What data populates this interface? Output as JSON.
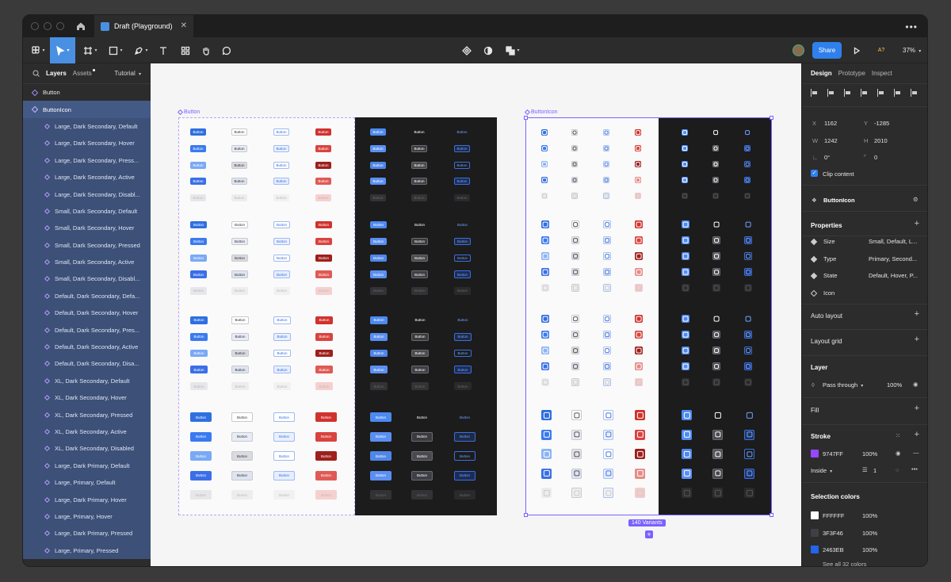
{
  "file_tab": {
    "title": "Draft (Playground)",
    "close": "✕"
  },
  "toolbar": {
    "share_label": "Share",
    "zoom": "37%",
    "ai_label": "A?"
  },
  "left_panel": {
    "tabs": {
      "layers": "Layers",
      "assets": "Assets",
      "page": "Tutorial"
    },
    "layers": [
      {
        "label": "Button",
        "level": "top"
      },
      {
        "label": "ButtonIcon",
        "level": "parent"
      },
      {
        "label": "Large, Dark Secondary, Default",
        "level": "child"
      },
      {
        "label": "Large, Dark Secondary, Hover",
        "level": "child"
      },
      {
        "label": "Large, Dark Secondary, Press...",
        "level": "child"
      },
      {
        "label": "Large, Dark Secondary, Active",
        "level": "child"
      },
      {
        "label": "Large, Dark Secondary, Disabl...",
        "level": "child"
      },
      {
        "label": "Small, Dark Secondary, Default",
        "level": "child"
      },
      {
        "label": "Small, Dark Secondary, Hover",
        "level": "child"
      },
      {
        "label": "Small, Dark Secondary, Pressed",
        "level": "child"
      },
      {
        "label": "Small, Dark Secondary, Active",
        "level": "child"
      },
      {
        "label": "Small, Dark Secondary, Disabl...",
        "level": "child"
      },
      {
        "label": "Default, Dark Secondary, Defa...",
        "level": "child"
      },
      {
        "label": "Default, Dark Secondary, Hover",
        "level": "child"
      },
      {
        "label": "Default, Dark Secondary, Pres...",
        "level": "child"
      },
      {
        "label": "Default, Dark Secondary, Active",
        "level": "child"
      },
      {
        "label": "Default, Dark Secondary, Disa...",
        "level": "child"
      },
      {
        "label": "XL, Dark Secondary, Default",
        "level": "child"
      },
      {
        "label": "XL, Dark Secondary, Hover",
        "level": "child"
      },
      {
        "label": "XL, Dark Secondary, Pressed",
        "level": "child"
      },
      {
        "label": "XL, Dark Secondary, Active",
        "level": "child"
      },
      {
        "label": "XL, Dark Secondary, Disabled",
        "level": "child"
      },
      {
        "label": "Large, Dark Primary, Default",
        "level": "child"
      },
      {
        "label": "Large, Primary, Default",
        "level": "child"
      },
      {
        "label": "Large, Dark Primary, Hover",
        "level": "child"
      },
      {
        "label": "Large, Primary, Hover",
        "level": "child"
      },
      {
        "label": "Large, Dark Primary, Pressed",
        "level": "child"
      },
      {
        "label": "Large, Primary, Pressed",
        "level": "child"
      }
    ]
  },
  "canvas": {
    "button_frame_label": "Button",
    "buttonicon_frame_label": "ButtonIcon",
    "button_text": "Button",
    "variants_badge": "140 Variants"
  },
  "right_panel": {
    "tabs": {
      "design": "Design",
      "prototype": "Prototype",
      "inspect": "Inspect"
    },
    "x_label": "X",
    "x": "1162",
    "y_label": "Y",
    "y": "-1285",
    "w_label": "W",
    "w": "1242",
    "h_label": "H",
    "h": "2010",
    "rotation": "0°",
    "radius": "0",
    "clip_content": "Clip content",
    "component_name": "ButtonIcon",
    "properties_title": "Properties",
    "properties": [
      {
        "name": "Size",
        "value": "Small, Default, L..."
      },
      {
        "name": "Type",
        "value": "Primary, Second..."
      },
      {
        "name": "State",
        "value": "Default, Hover, P..."
      },
      {
        "name": "Icon",
        "value": ""
      }
    ],
    "auto_layout": "Auto layout",
    "layout_grid": "Layout grid",
    "layer_title": "Layer",
    "blend_mode": "Pass through",
    "layer_opacity": "100%",
    "fill_title": "Fill",
    "stroke_title": "Stroke",
    "stroke_hex": "9747FF",
    "stroke_color": "#9747FF",
    "stroke_opacity": "100%",
    "stroke_position": "Inside",
    "stroke_weight": "1",
    "selection_colors_title": "Selection colors",
    "selection_colors": [
      {
        "hex": "FFFFFF",
        "color": "#FFFFFF",
        "opacity": "100%"
      },
      {
        "hex": "3F3F46",
        "color": "#3F3F46",
        "opacity": "100%"
      },
      {
        "hex": "2463EB",
        "color": "#2463EB",
        "opacity": "100%"
      }
    ],
    "see_all": "See all 32 colors"
  }
}
